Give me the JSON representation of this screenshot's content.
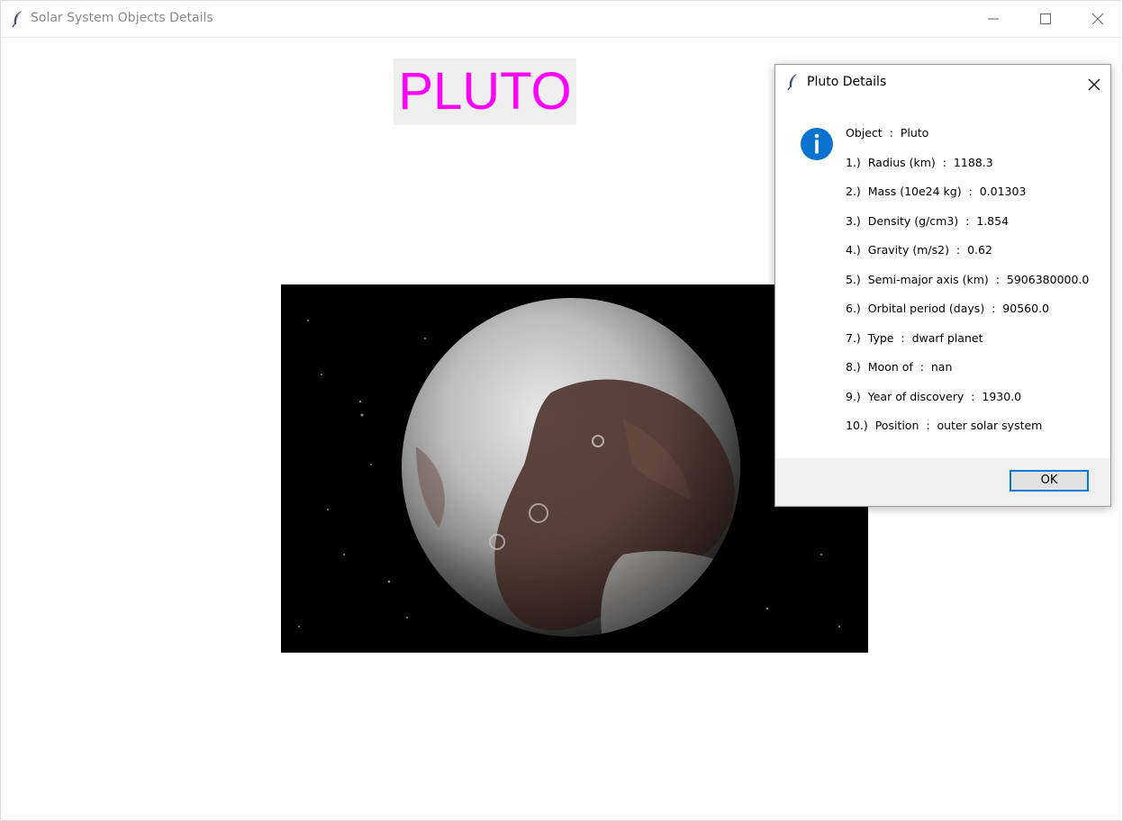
{
  "window": {
    "title": "Solar System Objects Details",
    "icon": "feather-icon"
  },
  "main": {
    "heading": "PLUTO",
    "heading_color": "#ff00ff",
    "image": "pluto-photo"
  },
  "dialog": {
    "title": "Pluto Details",
    "icon": "info-icon",
    "accent": "#0078d7",
    "lines": [
      "Object  :  Pluto",
      "1.)  Radius (km)  :  1188.3",
      "2.)  Mass (10e24 kg)  :  0.01303",
      "3.)  Density (g/cm3)  :  1.854",
      "4.)  Gravity (m/s2)  :  0.62",
      "5.)  Semi-major axis (km)  :  5906380000.0",
      "6.)  Orbital period (days)  :  90560.0",
      "7.)  Type  :  dwarf planet",
      "8.)  Moon of  :  nan",
      "9.)  Year of discovery  :  1930.0",
      "10.)  Position  :  outer solar system"
    ],
    "ok_label": "OK"
  }
}
